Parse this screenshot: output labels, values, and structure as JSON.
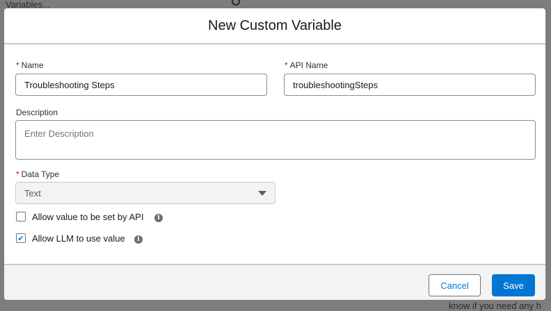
{
  "background": {
    "top_text": "Variables...",
    "bottom_text": "know if you need any h"
  },
  "modal": {
    "title": "New Custom Variable",
    "name": {
      "label": "Name",
      "value": "Troubleshooting Steps",
      "required": true
    },
    "api_name": {
      "label": "API Name",
      "value": "troubleshootingSteps",
      "required": true
    },
    "description": {
      "label": "Description",
      "placeholder": "Enter Description",
      "value": ""
    },
    "data_type": {
      "label": "Data Type",
      "value": "Text",
      "required": true
    },
    "checkboxes": [
      {
        "label": "Allow value to be set by API",
        "checked": false,
        "info_icon": "info-icon"
      },
      {
        "label": "Allow LLM to use value",
        "checked": true,
        "info_icon": "info-icon"
      }
    ],
    "required_marker": "*",
    "info_glyph": "i",
    "check_glyph": "✔",
    "footer": {
      "cancel": "Cancel",
      "save": "Save"
    },
    "colors": {
      "brand": "#0176d3",
      "required": "#ba0517"
    }
  }
}
